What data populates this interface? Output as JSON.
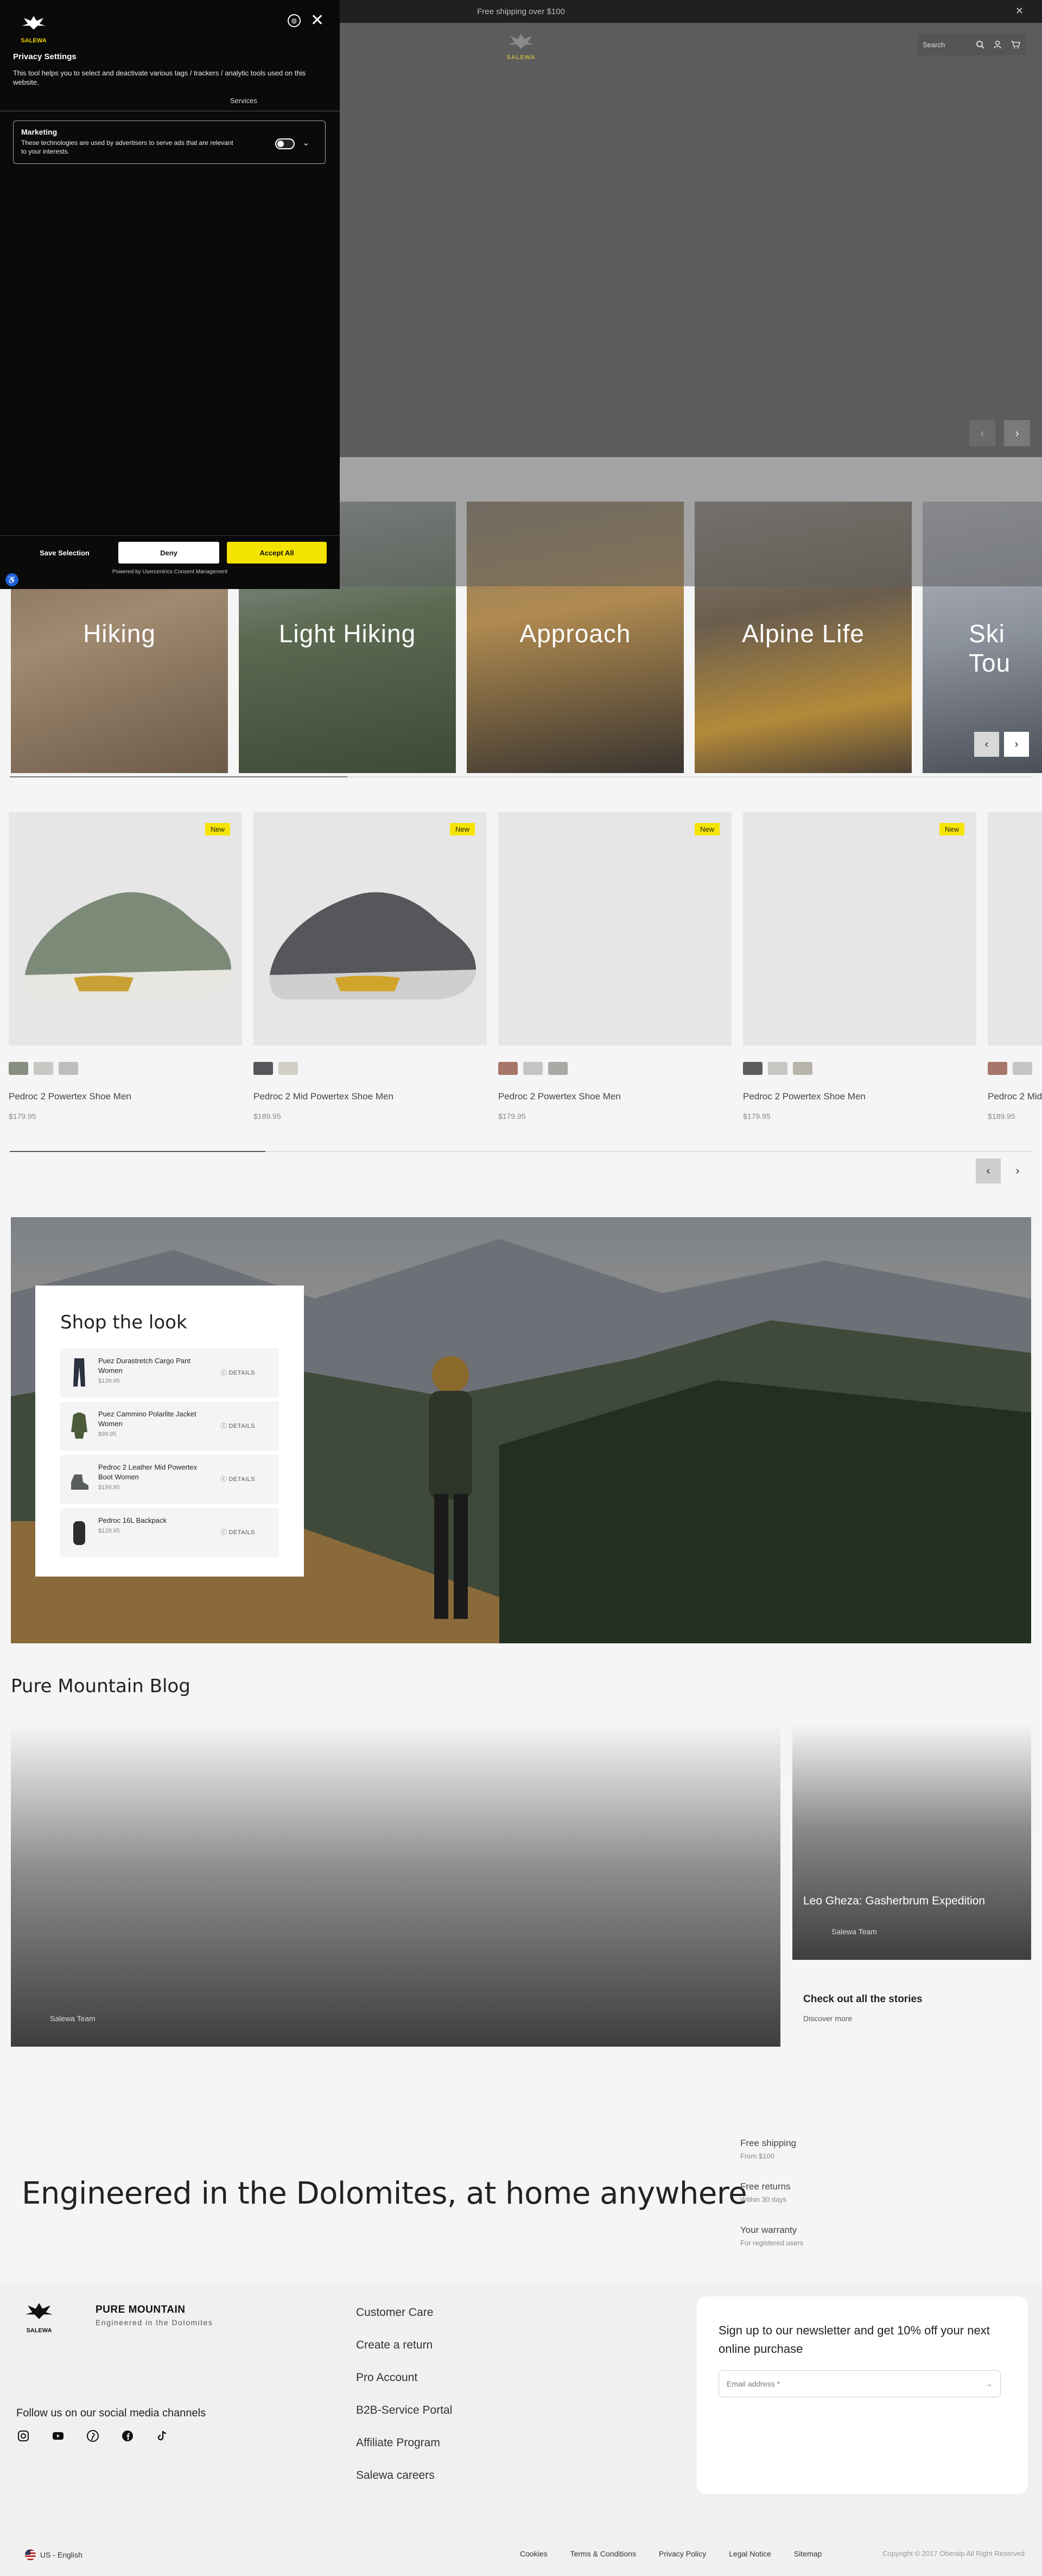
{
  "announcement": {
    "text": "Free shipping over $100",
    "close": "✕"
  },
  "header": {
    "logo_text": "SALEWA",
    "search_label": "Search"
  },
  "hero": {
    "prev": "‹",
    "next": "›"
  },
  "categories": [
    {
      "label": "Hiking"
    },
    {
      "label": "Light Hiking"
    },
    {
      "label": "Approach"
    },
    {
      "label": "Alpine Life"
    },
    {
      "label": "Ski Tou"
    }
  ],
  "category_slider": {
    "progress": 0.33,
    "prev": "‹",
    "next": "›"
  },
  "products": [
    {
      "name": "Pedroc 2 Powertex Shoe Men",
      "price": "$179.95",
      "badge": "New"
    },
    {
      "name": "Pedroc 2 Mid Powertex Shoe Men",
      "price": "$189.95",
      "badge": "New"
    },
    {
      "name": "Pedroc 2 Powertex Shoe Men",
      "price": "$179.95",
      "badge": "New"
    },
    {
      "name": "Pedroc 2 Powertex Shoe Men",
      "price": "$179.95",
      "badge": "New"
    },
    {
      "name": "Pedroc 2 Mid",
      "price": "$189.95",
      "badge": ""
    }
  ],
  "product_slider": {
    "progress": 0.25,
    "prev": "‹",
    "next": "›"
  },
  "shop_the_look": {
    "title": "Shop the look",
    "details_label": "DETAILS",
    "items": [
      {
        "name": "Puez Durastretch Cargo Pant Women",
        "price": "$139.95"
      },
      {
        "name": "Puez Cammino Polarlite Jacket Women",
        "price": "$99.95"
      },
      {
        "name": "Pedroc 2 Leather Mid Powertex Boot Women",
        "price": "$199.95"
      },
      {
        "name": "Pedroc 16L Backpack",
        "price": "$129.95"
      }
    ]
  },
  "blog": {
    "title": "Pure Mountain Blog",
    "main_author": "Salewa Team",
    "side_title": "Leo Gheza: Gasherbrum Expedition",
    "side_author": "Salewa Team",
    "more_title": "Check out all the stories",
    "more_link": "Discover more"
  },
  "claim": "Engineered in the Dolomites, at home anywhere",
  "usps": [
    {
      "title": "Free shipping",
      "sub": "From $100"
    },
    {
      "title": "Free returns",
      "sub": "Within 30 days"
    },
    {
      "title": "Your warranty",
      "sub": "For registered users"
    }
  ],
  "footer": {
    "logo_text": "SALEWA",
    "brand": "PURE MOUNTAIN",
    "brand_sub": "Engineered in the Dolomites",
    "social_heading": "Follow us on our social media channels",
    "links": [
      "Customer Care",
      "Create a return",
      "Pro Account",
      "B2B-Service Portal",
      "Affiliate Program",
      "Salewa careers"
    ],
    "newsletter_text": "Sign up to our newsletter and get 10% off your next online purchase",
    "email_placeholder": "Email address *",
    "locale": "US - English",
    "legal": [
      "Cookies",
      "Terms & Conditions",
      "Privacy Policy",
      "Legal Notice",
      "Sitemap"
    ],
    "copyright": "Copyright © 2017 Oberalp All Right Reserved"
  },
  "privacy": {
    "logo_text": "SALEWA",
    "title": "Privacy Settings",
    "description": "This tool helps you to select and deactivate various tags / trackers / analytic tools used on this website.",
    "tab": "Services",
    "category_title": "Marketing",
    "category_desc": "These technologies are used by advertisers to serve ads that are relevant to your interests.",
    "save": "Save Selection",
    "deny": "Deny",
    "accept": "Accept All",
    "powered": "Powered by Usercentrics Consent Management"
  },
  "colors": {
    "accent": "#f5e400",
    "dark": "#0a0a0a",
    "logo_gold": "#c9b245"
  }
}
